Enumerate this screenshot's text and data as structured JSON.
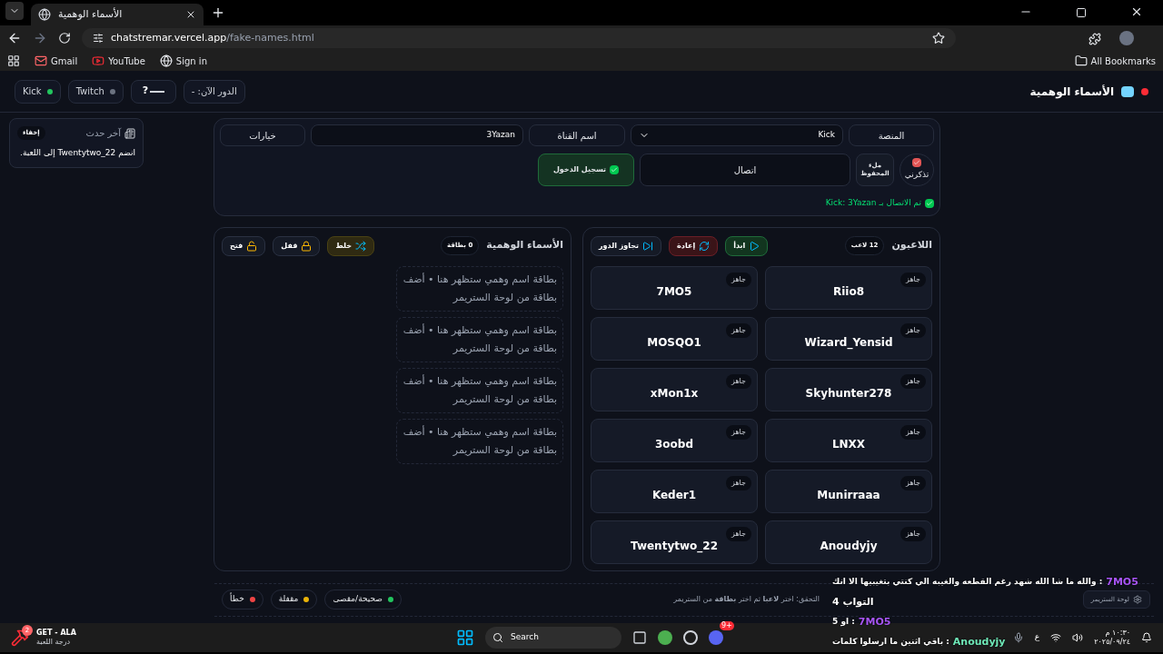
{
  "browser": {
    "tab_title": "الأسماء الوهمية",
    "url_host": "chatstremar.vercel.app",
    "url_path": "/fake-names.html",
    "bookmark_gmail": "Gmail",
    "bookmark_youtube": "YouTube",
    "bookmark_sign_in": "Sign in",
    "all_bookmarks": "All Bookmarks"
  },
  "header": {
    "title": "الأسماء الوهمية",
    "live": true,
    "platforms": [
      {
        "label": "Twitch",
        "color": "#6b7280"
      },
      {
        "label": "Kick",
        "color": "#22c55e"
      }
    ],
    "help": "?",
    "turn": "الدور الآن: -"
  },
  "event": {
    "title": "آخر حدث",
    "hide": "إخفاء",
    "text": "انضم Twentytwo_22 إلى اللعبة."
  },
  "controls": {
    "platform_label": "المنصة",
    "platform_value": "Kick",
    "channel_label": "اسم القناة",
    "channel_value": "3Yazan",
    "options": "خيارات",
    "remember": {
      "label": "تذكرني",
      "checked": true
    },
    "fill_saved": "ملء المحفوظ",
    "connect": "اتصال",
    "login": "تسجيل الدخول",
    "status": "تم الاتصال بـ Kick: 3Yazan"
  },
  "players": {
    "title": "اللاعبون",
    "count": "12 لاعب",
    "buttons": [
      {
        "label": "ابدأ",
        "kind": "green"
      },
      {
        "label": "إعادة",
        "kind": "red"
      },
      {
        "label": "تجاوز الدور",
        "kind": "plain"
      }
    ],
    "items": [
      {
        "name": "Riio8",
        "status": "جاهز"
      },
      {
        "name": "7MO5",
        "status": "جاهز"
      },
      {
        "name": "Wizard_Yensid",
        "status": "جاهز"
      },
      {
        "name": "MOSQO1",
        "status": "جاهز"
      },
      {
        "name": "Skyhunter278",
        "status": "جاهز"
      },
      {
        "name": "xMon1x",
        "status": "جاهز"
      },
      {
        "name": "LNXX",
        "status": "جاهز"
      },
      {
        "name": "3oobd",
        "status": "جاهز"
      },
      {
        "name": "Munirraaa",
        "status": "جاهز"
      },
      {
        "name": "Keder1",
        "status": "جاهز"
      },
      {
        "name": "Anoudyjy",
        "status": "جاهز"
      },
      {
        "name": "Twentytwo_22",
        "status": "جاهز"
      }
    ]
  },
  "names": {
    "title": "الأسماء الوهمية",
    "count": "0 بطاقة",
    "buttons": [
      {
        "label": "خلط",
        "kind": "yellow"
      },
      {
        "label": "قفل",
        "kind": "lock"
      },
      {
        "label": "فتح",
        "kind": "unlock"
      }
    ],
    "placeholders": [
      "بطاقة اسم وهمي ستظهر هنا • أضف بطاقة من لوحة الستريمر",
      "بطاقة اسم وهمي ستظهر هنا • أضف بطاقة من لوحة الستريمر",
      "بطاقة اسم وهمي ستظهر هنا • أضف بطاقة من لوحة الستريمر",
      "بطاقة اسم وهمي ستظهر هنا • أضف بطاقة من لوحة الستريمر"
    ]
  },
  "footer": {
    "streamer_panel": "لوحة الستريمر",
    "hint": "التحقق: اختر **لاعبا** ثم اختر **بطاقة** من الستريمر",
    "legend": [
      {
        "label": "صحيحة/مقصى",
        "color": "#22c55e"
      },
      {
        "label": "مقفلة",
        "color": "#eab308"
      },
      {
        "label": "خطأ",
        "color": "#ef4444"
      }
    ]
  },
  "chat": [
    {
      "kind": "message",
      "user": "7MO5",
      "color": "#a855f7",
      "text": ": والله ما شا الله شهد رغم القطعه والغيبه الي كنتي بتغيبيها الا انك"
    },
    {
      "kind": "continuation",
      "text": "التواب 4"
    },
    {
      "kind": "message",
      "user": "7MO5",
      "color": "#a855f7",
      "text": ": او 5"
    },
    {
      "kind": "message",
      "user": "Anoudyjy",
      "color": "#6ee7b7",
      "text": ": باقي اثنين ما ارسلوا كلمات"
    }
  ],
  "taskbar": {
    "widget_title": "GET - ALA",
    "widget_subtitle": "درجة اللعبة",
    "widget_badge": "2",
    "search": "Search",
    "discord_badge": "9+",
    "lang": "ع",
    "time": "١٠:٣٠ م",
    "date": "٢٠٢٥/٠٩/٢٤"
  }
}
